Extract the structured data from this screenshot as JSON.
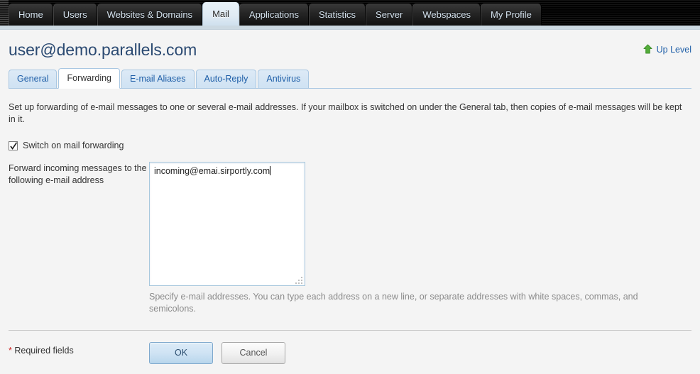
{
  "topnav": {
    "items": [
      {
        "label": "Home",
        "active": false
      },
      {
        "label": "Users",
        "active": false
      },
      {
        "label": "Websites & Domains",
        "active": false
      },
      {
        "label": "Mail",
        "active": true
      },
      {
        "label": "Applications",
        "active": false
      },
      {
        "label": "Statistics",
        "active": false
      },
      {
        "label": "Server",
        "active": false
      },
      {
        "label": "Webspaces",
        "active": false
      },
      {
        "label": "My Profile",
        "active": false
      }
    ]
  },
  "header": {
    "title": "user@demo.parallels.com",
    "up_level_label": "Up Level",
    "up_level_icon": "arrow-up-icon",
    "up_level_color": "#4a9f35"
  },
  "subtabs": {
    "items": [
      {
        "label": "General",
        "active": false
      },
      {
        "label": "Forwarding",
        "active": true
      },
      {
        "label": "E-mail Aliases",
        "active": false
      },
      {
        "label": "Auto-Reply",
        "active": false
      },
      {
        "label": "Antivirus",
        "active": false
      }
    ]
  },
  "main": {
    "intro": "Set up forwarding of e-mail messages to one or several e-mail addresses. If your mailbox is switched on under the General tab, then copies of e-mail messages will be kept in it.",
    "switch_checkbox": {
      "label": "Switch on mail forwarding",
      "checked": true
    },
    "forward_field": {
      "label": "Forward incoming messages to the following e-mail address",
      "value": "incoming@emai.sirportly.com",
      "placeholder": "",
      "hint": "Specify e-mail addresses. You can type each address on a new line, or separate addresses with white spaces, commas, and semicolons."
    }
  },
  "footer": {
    "required_star": "*",
    "required_label": " Required fields",
    "ok_label": "OK",
    "cancel_label": "Cancel"
  },
  "colors": {
    "accent_blue": "#1f5fa8",
    "title_blue": "#2b4a72",
    "required_red": "#cc2222",
    "nav_black": "#000000",
    "content_bg": "#f4f4f4"
  }
}
